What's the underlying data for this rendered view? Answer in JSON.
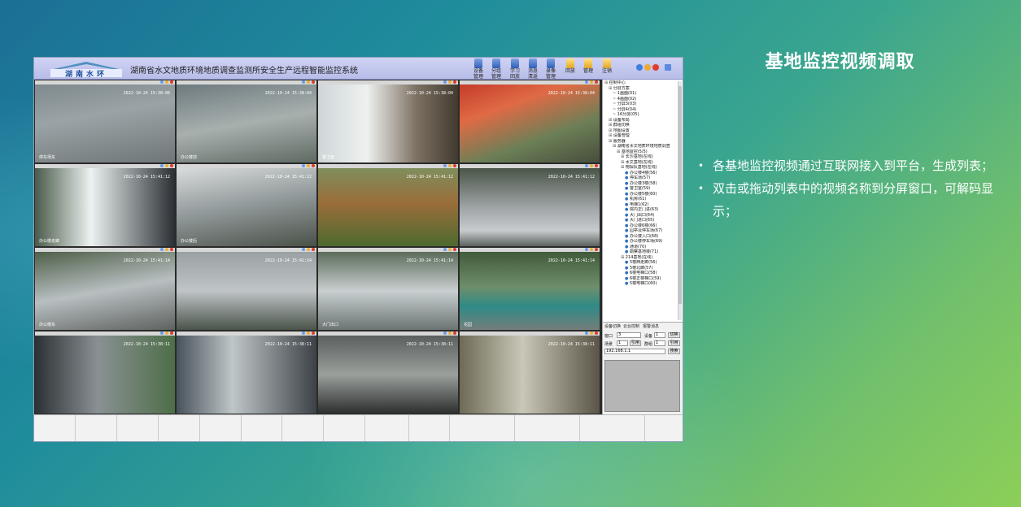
{
  "slide": {
    "heading": "基地监控视频调取",
    "bullets": [
      "各基地监控视频通过互联网接入到平台，生成列表；",
      "双击或拖动列表中的视频名称到分屏窗口，可解码显示；"
    ]
  },
  "app": {
    "logo_text": "湖南水环",
    "title": "湖南省水文地质环境地质调查监测所安全生产远程智能监控系统",
    "toolbar": [
      "管理",
      "管理",
      "回放",
      "清返",
      "管理",
      "回放",
      "管理",
      "注销"
    ],
    "toolbar_top": [
      "设备",
      "分组",
      "学习",
      "消息",
      "录像",
      "",
      "",
      ""
    ],
    "tiles": [
      {
        "name": "停车场东",
        "time": "2022-10-24 15:38:06"
      },
      {
        "name": "办公楼前",
        "time": "2022-10-24 15:38:04"
      },
      {
        "name": "警卫室",
        "time": "2022-10-24 15:38:04"
      },
      {
        "name": "",
        "time": "2022-10-24 15:38:04"
      },
      {
        "name": "办公楼走廊",
        "time": "2022-10-24 15:41:12"
      },
      {
        "name": "办公楼后",
        "time": "2022-10-24 15:41:12"
      },
      {
        "name": "",
        "time": "2022-10-24 15:41:12"
      },
      {
        "name": "",
        "time": "2022-10-24 15:41:12"
      },
      {
        "name": "办公楼东",
        "time": "2022-10-24 15:41:14"
      },
      {
        "name": "",
        "time": "2022-10-24 15:41:14"
      },
      {
        "name": "大门出口",
        "time": "2022-10-24 15:41:14"
      },
      {
        "name": "花园",
        "time": "2022-10-24 15:41:14"
      },
      {
        "name": "",
        "time": "2022-10-24 15:38:11"
      },
      {
        "name": "",
        "time": "2022-10-24 15:38:11"
      },
      {
        "name": "",
        "time": "2022-10-24 15:38:11"
      },
      {
        "name": "",
        "time": "2022-10-24 15:38:11"
      }
    ],
    "tree": [
      {
        "t": "控制中心",
        "d": 0
      },
      {
        "t": "分屏方案",
        "d": 1
      },
      {
        "t": "1画面(01)",
        "d": 2
      },
      {
        "t": "4画面(02)",
        "d": 2
      },
      {
        "t": "分屏3(03)",
        "d": 2
      },
      {
        "t": "分屏4(04)",
        "d": 2
      },
      {
        "t": "16分屏(05)",
        "d": 2
      },
      {
        "t": "设备布局",
        "d": 1
      },
      {
        "t": "群组切换",
        "d": 1
      },
      {
        "t": "地图设置",
        "d": 1
      },
      {
        "t": "设备管理",
        "d": 1
      },
      {
        "t": "服务器",
        "d": 1
      },
      {
        "t": "湖南省水文地质环境地质调查",
        "d": 2
      },
      {
        "t": "基地监控(5/5)",
        "d": 3
      },
      {
        "t": "长沙基地(在线)",
        "d": 4
      },
      {
        "t": "水文基地(在线)",
        "d": 4
      },
      {
        "t": "物探队基地(在线)",
        "d": 4
      },
      {
        "t": "办公楼4楼(56)",
        "d": 5
      },
      {
        "t": "停车场(57)",
        "d": 5
      },
      {
        "t": "办公楼3楼(58)",
        "d": 5
      },
      {
        "t": "警卫室(59)",
        "d": 5
      },
      {
        "t": "办公楼5楼(60)",
        "d": 5
      },
      {
        "t": "机房(61)",
        "d": 5
      },
      {
        "t": "电梯1(62)",
        "d": 5
      },
      {
        "t": "院内正门进(63)",
        "d": 5
      },
      {
        "t": "大门出口(64)",
        "d": 5
      },
      {
        "t": "大门进口(65)",
        "d": 5
      },
      {
        "t": "办公楼6楼(66)",
        "d": 5
      },
      {
        "t": "园亭及停车场(67)",
        "d": 5
      },
      {
        "t": "办公楼入口(68)",
        "d": 5
      },
      {
        "t": "办公楼停车场(69)",
        "d": 5
      },
      {
        "t": "通道(70)",
        "d": 5
      },
      {
        "t": "勘察基地楼(71)",
        "d": 5
      },
      {
        "t": "214基地(在线)",
        "d": 4
      },
      {
        "t": "5楼西走廊(56)",
        "d": 5
      },
      {
        "t": "5楼北廊(57)",
        "d": 5
      },
      {
        "t": "6楼电梯口(58)",
        "d": 5
      },
      {
        "t": "6楼正楼梯口(59)",
        "d": 5
      },
      {
        "t": "5楼电梯口(60)",
        "d": 5
      }
    ],
    "panel": {
      "tabs": [
        "设备切换",
        "云台控制",
        "报警消息"
      ],
      "window_label": "窗口",
      "window_value": "3",
      "device_label": "设备",
      "device_value": "1",
      "switch_label": "切换",
      "scene_label": "场景",
      "scene_value": "1",
      "call_label": "引用",
      "group_label": "群组",
      "group_value": "1",
      "call2_label": "引用",
      "ip_value": "192.168.1.1",
      "search_label": "搜索"
    }
  }
}
